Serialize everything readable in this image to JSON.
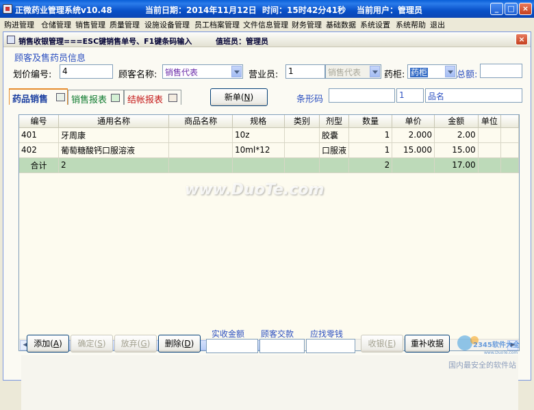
{
  "titlebar": {
    "title": "正微药业管理系统v10.48",
    "date": "当前日期：2014年11月12日",
    "time": "时间：15时42分41秒",
    "user": "当前用户：管理员",
    "min": "_",
    "max": "□",
    "close": "×"
  },
  "menu": [
    "购进管理",
    "仓储管理",
    "销售管理",
    "质量管理",
    "设施设备管理",
    "员工档案管理",
    "文件信息管理",
    "财务管理",
    "基础数据",
    "系统设置",
    "系统帮助",
    "退出"
  ],
  "window": {
    "title": "销售收银管理===ESC键销售单号、F1键条码输入",
    "cashier": "值班员：管理员",
    "close": "×"
  },
  "form": {
    "section_title": "顾客及售药员信息",
    "price_no_label": "划价编号:",
    "price_no": "4",
    "customer_label": "顾客名称:",
    "customer": "销售代表",
    "staff_label": "营业员:",
    "staff_id": "1",
    "staff_name": "销售代表",
    "cabinet_label": "药柜:",
    "cabinet": "药柜",
    "total_label": "总额:",
    "total": ""
  },
  "tabs": [
    "药品销售",
    "销售报表",
    "结帐报表"
  ],
  "new_button": {
    "label": "新单(",
    "key": "N",
    "end": ")"
  },
  "barcode": {
    "label": "条形码",
    "value": "",
    "qty": "1",
    "name": "品名"
  },
  "table": {
    "headers": [
      "编号",
      "通用名称",
      "商品名称",
      "规格",
      "类别",
      "剂型",
      "数量",
      "单价",
      "金额",
      "单位"
    ],
    "rows": [
      [
        "401",
        "牙周康",
        "",
        "10z",
        "",
        "胶囊",
        "1",
        "2.000",
        "2.00",
        ""
      ],
      [
        "402",
        "葡萄糖酸钙口服溶液",
        "",
        "10ml*12",
        "",
        "口服液",
        "1",
        "15.000",
        "15.00",
        ""
      ]
    ],
    "total_row": [
      "合计",
      "2",
      "",
      "",
      "",
      "",
      "2",
      "",
      "17.00",
      ""
    ]
  },
  "bottom": {
    "add": {
      "label": "添加(",
      "key": "A",
      "end": ")"
    },
    "confirm": {
      "label": "确定(",
      "key": "S",
      "end": ")"
    },
    "discard": {
      "label": "放弃(",
      "key": "G",
      "end": ")"
    },
    "delete": {
      "label": "删除(",
      "key": "D",
      "end": ")"
    },
    "received_label": "实收金额",
    "paid_label": "顾客交款",
    "change_label": "应找零钱",
    "checkout": {
      "label": "收银(",
      "key": "E",
      "end": ")"
    },
    "reprint": "重补收据"
  },
  "watermark": "www.DuoTe.com",
  "corner_logo": {
    "brand": "2345软件大全",
    "slogan": "国内最安全的软件站",
    "site": "www.DuoTe.com"
  }
}
